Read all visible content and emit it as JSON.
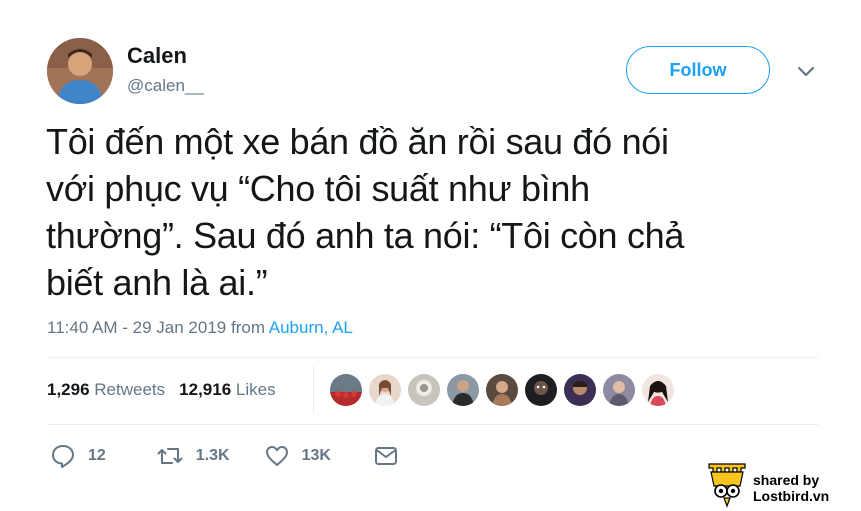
{
  "author": {
    "name": "Calen",
    "handle": "@calen__"
  },
  "follow_label": "Follow",
  "tweet": {
    "text": "Tôi  đến một xe bán đồ ăn rồi sau đó nói\nvới phục vụ “Cho tôi suất như bình\nthường”. Sau đó anh ta nói: “Tôi còn chả\nbiết anh là ai.”",
    "time_date": "11:40 AM - 29 Jan 2019 from ",
    "location": "Auburn, AL"
  },
  "stats": {
    "retweets_count": "1,296",
    "retweets_label": "Retweets",
    "likes_count": "12,916",
    "likes_label": "Likes"
  },
  "actions": {
    "replies": "12",
    "retweets": "1.3K",
    "likes": "13K"
  },
  "watermark": {
    "line1": "shared by",
    "line2": "Lostbird.vn"
  },
  "icons": [
    "chevron-down-icon",
    "reply-icon",
    "retweet-icon",
    "heart-icon",
    "message-icon",
    "lostbird-logo-icon"
  ],
  "colors": {
    "accent": "#1da1f2",
    "muted": "#657786",
    "text": "#14171a",
    "divider": "#e6ecf0"
  }
}
